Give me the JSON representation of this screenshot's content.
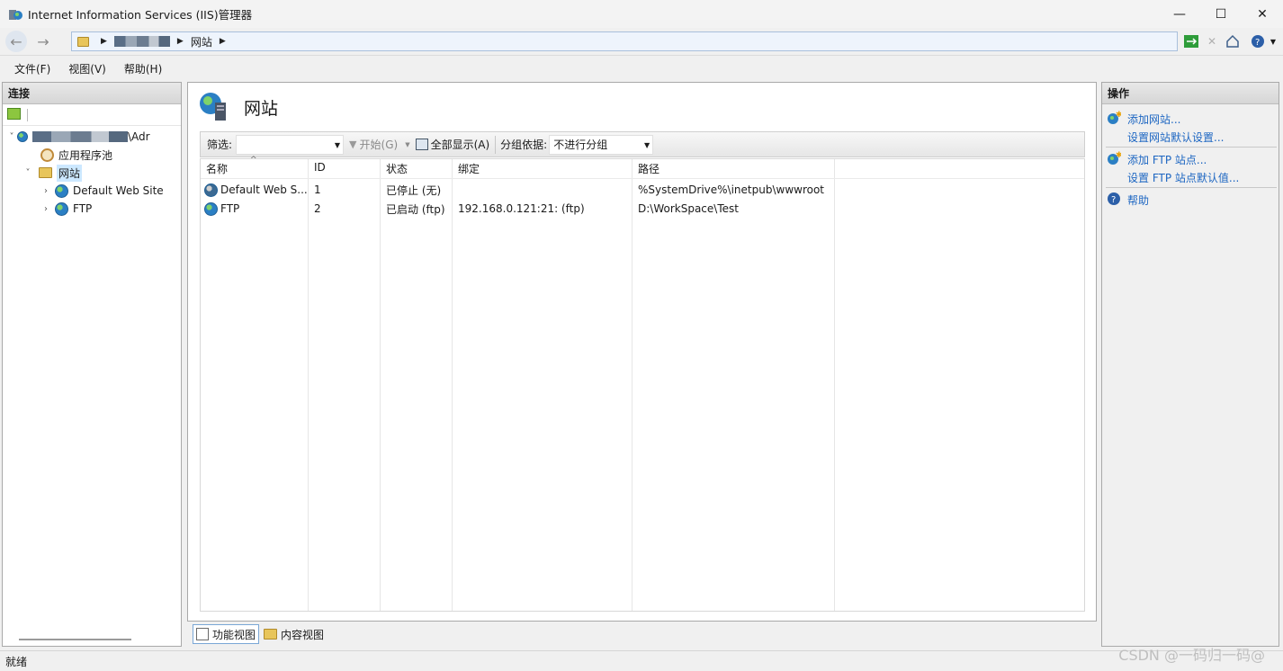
{
  "window": {
    "title": "Internet Information Services (IIS)管理器",
    "minimize_glyph": "—",
    "maximize_glyph": "☐",
    "close_glyph": "✕"
  },
  "address": {
    "crumbs": [
      "网站"
    ]
  },
  "menu": [
    "文件(F)",
    "视图(V)",
    "帮助(H)"
  ],
  "connections": {
    "title": "连接",
    "server_suffix": "\\Adr",
    "items": [
      {
        "label": "应用程序池"
      },
      {
        "label": "网站"
      },
      {
        "label": "Default Web Site"
      },
      {
        "label": "FTP"
      }
    ]
  },
  "center": {
    "title": "网站",
    "filter_label": "筛选:",
    "filter_value": "",
    "start_label": "开始(G)",
    "show_all_label": "全部显示(A)",
    "group_label": "分组依据:",
    "group_value": "不进行分组",
    "columns": [
      "名称",
      "ID",
      "状态",
      "绑定",
      "路径"
    ],
    "rows": [
      {
        "name": "Default Web S...",
        "id": "1",
        "status": "已停止 (无)",
        "binding": "",
        "path": "%SystemDrive%\\inetpub\\wwwroot"
      },
      {
        "name": "FTP",
        "id": "2",
        "status": "已启动 (ftp)",
        "binding": "192.168.0.121:21: (ftp)",
        "path": "D:\\WorkSpace\\Test"
      }
    ]
  },
  "bottom_tabs": [
    "功能视图",
    "内容视图"
  ],
  "actions": {
    "title": "操作",
    "items": [
      "添加网站...",
      "设置网站默认设置...",
      "添加 FTP 站点...",
      "设置 FTP 站点默认值...",
      "帮助"
    ]
  },
  "status": "就绪",
  "watermark": "CSDN @一码归一码@",
  "colors": {
    "link": "#1d66c2",
    "pane_border": "#a9a9a9",
    "address_bg": "#eef4fc"
  }
}
